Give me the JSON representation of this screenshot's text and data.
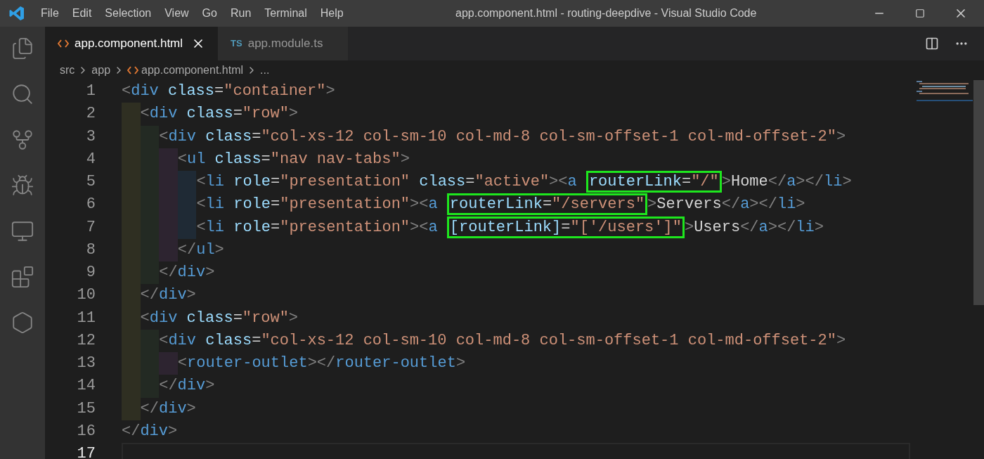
{
  "window": {
    "title": "app.component.html - routing-deepdive - Visual Studio Code"
  },
  "menu": [
    "File",
    "Edit",
    "Selection",
    "View",
    "Go",
    "Run",
    "Terminal",
    "Help"
  ],
  "tabs": [
    {
      "label": "app.component.html",
      "kind": "html",
      "selected": true
    },
    {
      "label": "app.module.ts",
      "kind": "ts",
      "badge": "TS",
      "selected": false
    }
  ],
  "breadcrumb": [
    {
      "label": "src",
      "kind": "folder"
    },
    {
      "label": "app",
      "kind": "folder"
    },
    {
      "label": "app.component.html",
      "kind": "html"
    },
    {
      "label": "...",
      "kind": "more"
    }
  ],
  "editor": {
    "lines": [
      {
        "number": "1",
        "current": false,
        "tokens": [
          {
            "kind": "punct",
            "text": "<"
          },
          {
            "kind": "tag",
            "text": "div"
          },
          {
            "kind": "attr",
            "text": " class"
          },
          {
            "kind": "eq",
            "text": "="
          },
          {
            "kind": "str",
            "text": "\"container\""
          },
          {
            "kind": "punct",
            "text": ">"
          }
        ],
        "children": [
          {
            "number": "2",
            "current": false,
            "tokens": [
              {
                "kind": "punct",
                "text": "<"
              },
              {
                "kind": "tag",
                "text": "div"
              },
              {
                "kind": "attr",
                "text": " class"
              },
              {
                "kind": "eq",
                "text": "="
              },
              {
                "kind": "str",
                "text": "\"row\""
              },
              {
                "kind": "punct",
                "text": ">"
              }
            ],
            "children": [
              {
                "number": "3",
                "current": false,
                "tokens": [
                  {
                    "kind": "punct",
                    "text": "<"
                  },
                  {
                    "kind": "tag",
                    "text": "div"
                  },
                  {
                    "kind": "attr",
                    "text": " class"
                  },
                  {
                    "kind": "eq",
                    "text": "="
                  },
                  {
                    "kind": "str",
                    "text": "\"col-xs-12 col-sm-10 col-md-8 col-sm-offset-1 col-md-offset-2\""
                  },
                  {
                    "kind": "punct",
                    "text": ">"
                  }
                ],
                "children": [
                  {
                    "number": "4",
                    "current": false,
                    "tokens": [
                      {
                        "kind": "punct",
                        "text": "<"
                      },
                      {
                        "kind": "tag",
                        "text": "ul"
                      },
                      {
                        "kind": "attr",
                        "text": " class"
                      },
                      {
                        "kind": "eq",
                        "text": "="
                      },
                      {
                        "kind": "str",
                        "text": "\"nav nav-tabs\""
                      },
                      {
                        "kind": "punct",
                        "text": ">"
                      }
                    ],
                    "children": [
                      {
                        "number": "5",
                        "current": false,
                        "tokens": [
                          {
                            "kind": "punct",
                            "text": "<"
                          },
                          {
                            "kind": "tag",
                            "text": "li"
                          },
                          {
                            "kind": "attr",
                            "text": " role"
                          },
                          {
                            "kind": "eq",
                            "text": "="
                          },
                          {
                            "kind": "str",
                            "text": "\"presentation\""
                          },
                          {
                            "kind": "attr",
                            "text": " class"
                          },
                          {
                            "kind": "eq",
                            "text": "="
                          },
                          {
                            "kind": "str",
                            "text": "\"active\""
                          },
                          {
                            "kind": "punct",
                            "text": "><"
                          },
                          {
                            "kind": "tag",
                            "text": "a"
                          },
                          {
                            "kind": "highlight",
                            "tokens": [
                              {
                                "kind": "attr",
                                "text": "routerLink"
                              },
                              {
                                "kind": "eq",
                                "text": "="
                              },
                              {
                                "kind": "str",
                                "text": "\"/\""
                              }
                            ]
                          },
                          {
                            "kind": "punct",
                            "text": ">"
                          },
                          {
                            "kind": "text",
                            "text": "Home"
                          },
                          {
                            "kind": "punct",
                            "text": "</"
                          },
                          {
                            "kind": "tag",
                            "text": "a"
                          },
                          {
                            "kind": "punct",
                            "text": "></"
                          },
                          {
                            "kind": "tag",
                            "text": "li"
                          },
                          {
                            "kind": "punct",
                            "text": ">"
                          }
                        ]
                      },
                      {
                        "number": "6",
                        "current": false,
                        "tokens": [
                          {
                            "kind": "punct",
                            "text": "<"
                          },
                          {
                            "kind": "tag",
                            "text": "li"
                          },
                          {
                            "kind": "attr",
                            "text": " role"
                          },
                          {
                            "kind": "eq",
                            "text": "="
                          },
                          {
                            "kind": "str",
                            "text": "\"presentation\""
                          },
                          {
                            "kind": "punct",
                            "text": "><"
                          },
                          {
                            "kind": "tag",
                            "text": "a"
                          },
                          {
                            "kind": "highlight",
                            "tokens": [
                              {
                                "kind": "attr",
                                "text": "routerLink"
                              },
                              {
                                "kind": "eq",
                                "text": "="
                              },
                              {
                                "kind": "str",
                                "text": "\"/servers\""
                              }
                            ]
                          },
                          {
                            "kind": "punct",
                            "text": ">"
                          },
                          {
                            "kind": "text",
                            "text": "Servers"
                          },
                          {
                            "kind": "punct",
                            "text": "</"
                          },
                          {
                            "kind": "tag",
                            "text": "a"
                          },
                          {
                            "kind": "punct",
                            "text": "></"
                          },
                          {
                            "kind": "tag",
                            "text": "li"
                          },
                          {
                            "kind": "punct",
                            "text": ">"
                          }
                        ]
                      },
                      {
                        "number": "7",
                        "current": false,
                        "tokens": [
                          {
                            "kind": "punct",
                            "text": "<"
                          },
                          {
                            "kind": "tag",
                            "text": "li"
                          },
                          {
                            "kind": "attr",
                            "text": " role"
                          },
                          {
                            "kind": "eq",
                            "text": "="
                          },
                          {
                            "kind": "str",
                            "text": "\"presentation\""
                          },
                          {
                            "kind": "punct",
                            "text": "><"
                          },
                          {
                            "kind": "tag",
                            "text": "a"
                          },
                          {
                            "kind": "highlight",
                            "tokens": [
                              {
                                "kind": "attr",
                                "text": "[routerLink]"
                              },
                              {
                                "kind": "eq",
                                "text": "="
                              },
                              {
                                "kind": "str",
                                "text": "\"['/users']\""
                              }
                            ]
                          },
                          {
                            "kind": "punct",
                            "text": ">"
                          },
                          {
                            "kind": "text",
                            "text": "Users"
                          },
                          {
                            "kind": "punct",
                            "text": "</"
                          },
                          {
                            "kind": "tag",
                            "text": "a"
                          },
                          {
                            "kind": "punct",
                            "text": "></"
                          },
                          {
                            "kind": "tag",
                            "text": "li"
                          },
                          {
                            "kind": "punct",
                            "text": ">"
                          }
                        ]
                      }
                    ]
                  },
                  {
                    "number": "8",
                    "current": false,
                    "tokens": [
                      {
                        "kind": "punct",
                        "text": "</"
                      },
                      {
                        "kind": "tag",
                        "text": "ul"
                      },
                      {
                        "kind": "punct",
                        "text": ">"
                      }
                    ]
                  }
                ]
              },
              {
                "number": "9",
                "current": false,
                "tokens": [
                  {
                    "kind": "punct",
                    "text": "</"
                  },
                  {
                    "kind": "tag",
                    "text": "div"
                  },
                  {
                    "kind": "punct",
                    "text": ">"
                  }
                ]
              }
            ]
          },
          {
            "number": "10",
            "current": false,
            "tokens": [
              {
                "kind": "punct",
                "text": "</"
              },
              {
                "kind": "tag",
                "text": "div"
              },
              {
                "kind": "punct",
                "text": ">"
              }
            ]
          },
          {
            "number": "11",
            "current": false,
            "tokens": [
              {
                "kind": "punct",
                "text": "<"
              },
              {
                "kind": "tag",
                "text": "div"
              },
              {
                "kind": "attr",
                "text": " class"
              },
              {
                "kind": "eq",
                "text": "="
              },
              {
                "kind": "str",
                "text": "\"row\""
              },
              {
                "kind": "punct",
                "text": ">"
              }
            ],
            "children": [
              {
                "number": "12",
                "current": false,
                "tokens": [
                  {
                    "kind": "punct",
                    "text": "<"
                  },
                  {
                    "kind": "tag",
                    "text": "div"
                  },
                  {
                    "kind": "attr",
                    "text": " class"
                  },
                  {
                    "kind": "eq",
                    "text": "="
                  },
                  {
                    "kind": "str",
                    "text": "\"col-xs-12 col-sm-10 col-md-8 col-sm-offset-1 col-md-offset-2\""
                  },
                  {
                    "kind": "punct",
                    "text": ">"
                  }
                ],
                "children": [
                  {
                    "number": "13",
                    "current": false,
                    "tokens": [
                      {
                        "kind": "punct",
                        "text": "<"
                      },
                      {
                        "kind": "tag",
                        "text": "router-outlet"
                      },
                      {
                        "kind": "punct",
                        "text": "></"
                      },
                      {
                        "kind": "tag",
                        "text": "router-outlet"
                      },
                      {
                        "kind": "punct",
                        "text": ">"
                      }
                    ]
                  }
                ]
              },
              {
                "number": "14",
                "current": false,
                "tokens": [
                  {
                    "kind": "punct",
                    "text": "</"
                  },
                  {
                    "kind": "tag",
                    "text": "div"
                  },
                  {
                    "kind": "punct",
                    "text": ">"
                  }
                ]
              }
            ]
          },
          {
            "number": "15",
            "current": false,
            "tokens": [
              {
                "kind": "punct",
                "text": "</"
              },
              {
                "kind": "tag",
                "text": "div"
              },
              {
                "kind": "punct",
                "text": ">"
              }
            ]
          }
        ]
      },
      {
        "number": "16",
        "current": false,
        "tokens": [
          {
            "kind": "punct",
            "text": "</"
          },
          {
            "kind": "tag",
            "text": "div"
          },
          {
            "kind": "punct",
            "text": ">"
          }
        ]
      },
      {
        "number": "17",
        "current": true
      }
    ]
  }
}
